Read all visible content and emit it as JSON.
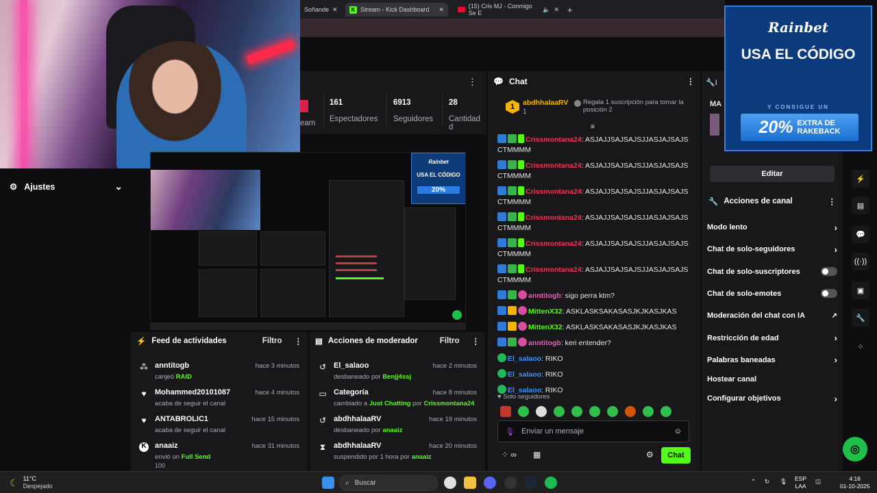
{
  "browser": {
    "tabs": [
      {
        "label": "Soñande"
      },
      {
        "label": "Stream - Kick Dashboard"
      },
      {
        "label": "(15) Cris MJ - Conmigo Se E"
      }
    ],
    "close_glyph": "✕",
    "new_tab_glyph": "+"
  },
  "left": {
    "settings_label": "Ajustes"
  },
  "stats": [
    {
      "value": "",
      "label": "eam"
    },
    {
      "value": "161",
      "label": "Espectadores"
    },
    {
      "value": "6913",
      "label": "Seguidores"
    },
    {
      "value": "28",
      "label": "Cantidad d"
    }
  ],
  "feed": {
    "title": "Feed de actividades",
    "filter": "Filtro",
    "items": [
      {
        "icon": "raid-icon",
        "name": "anntitogb",
        "time": "hace 3 minutos",
        "desc": "canjeó ",
        "highlight": "RAID"
      },
      {
        "icon": "heart-icon",
        "name": "Mohammed20101087",
        "time": "hace 4 minutos",
        "desc": "acaba de seguir el canal",
        "highlight": ""
      },
      {
        "icon": "heart-icon",
        "name": "ANTABROLIC1",
        "time": "hace 15 minutos",
        "desc": "acaba de seguir el canal",
        "highlight": ""
      },
      {
        "icon": "kick-icon",
        "name": "anaaiz",
        "time": "hace 31 minutos",
        "desc": "envió un ",
        "highlight": "Full Send",
        "extra": "100"
      }
    ]
  },
  "mod": {
    "title": "Acciones de moderador",
    "filter": "Filtro",
    "items": [
      {
        "icon": "undo-icon",
        "name": "El_salaoo",
        "time": "hace 2 minutos",
        "desc": "desbaneado por ",
        "by": "Benjj4ssj"
      },
      {
        "icon": "category-icon",
        "name": "Categoría",
        "time": "hace 8 minutos",
        "desc": "cambiado a ",
        "mid": "Just Chatting",
        "desc2": " por ",
        "by": "Crissmontana24"
      },
      {
        "icon": "undo-icon",
        "name": "abdhhalaaRV",
        "time": "hace 19 minutos",
        "desc": "desbaneado por ",
        "by": "anaaiz"
      },
      {
        "icon": "hourglass-icon",
        "name": "abdhhalaaRV",
        "time": "hace 20 minutos",
        "desc": "suspendido por 1 hora por ",
        "by": "anaaiz"
      }
    ]
  },
  "chat": {
    "title": "Chat",
    "pinned_user": "abdhhalaaRV",
    "pinned_rank": "1",
    "pinned_count": "1",
    "pinned_note": "Regala 1 suscripción para tomar la posición 2",
    "messages": [
      {
        "user": "Crissmontana24",
        "color": "red",
        "text": ": ASJAJJSAJSAJSJJASJAJSAJS CTMMMM"
      },
      {
        "user": "Crissmontana24",
        "color": "red",
        "text": ": ASJAJJSAJSAJSJJASJAJSAJS CTMMMM"
      },
      {
        "user": "Crissmontana24",
        "color": "red",
        "text": ": ASJAJJSAJSAJSJJASJAJSAJS CTMMMM"
      },
      {
        "user": "Crissmontana24",
        "color": "red",
        "text": ": ASJAJJSAJSAJSJJASJAJSAJS CTMMMM"
      },
      {
        "user": "Crissmontana24",
        "color": "red",
        "text": ": ASJAJJSAJSAJSJJASJAJSAJS CTMMMM"
      },
      {
        "user": "Crissmontana24",
        "color": "red",
        "text": ": ASJAJJSAJSAJSJJASJAJSAJS CTMMMM"
      },
      {
        "user": "anntitogb",
        "color": "pink",
        "text": ": sigo perra ktm?"
      },
      {
        "user": "MittenX32",
        "color": "green",
        "text": ": ASKLASKSAKASASJKJKASJKAS"
      },
      {
        "user": "MittenX32",
        "color": "green",
        "text": ": ASKLASKSAKASASJKJKASJKAS"
      },
      {
        "user": "anntitogb",
        "color": "pink",
        "text": ": keri entender?"
      },
      {
        "user": "El_salaoo",
        "color": "blue",
        "text": ": RIKO"
      },
      {
        "user": "El_salaoo",
        "color": "blue",
        "text": ": RIKO"
      },
      {
        "user": "El_salaoo",
        "color": "blue",
        "text": ": RIKO"
      }
    ],
    "followers_only": "Solo seguidores",
    "input_placeholder": "Enviar un mensaje",
    "send_label": "Chat"
  },
  "right": {
    "partial_title": "I",
    "partial_label": "MA",
    "edit_label": "Editar",
    "actions_title": "Acciones de canal",
    "options": [
      {
        "label": "Modo lento",
        "control": "chevron"
      },
      {
        "label": "Chat de solo-seguidores",
        "control": "chevron"
      },
      {
        "label": "Chat de solo-suscriptores",
        "control": "toggle"
      },
      {
        "label": "Chat de solo-emotes",
        "control": "toggle"
      },
      {
        "label": "Moderación del chat con IA",
        "control": "external"
      },
      {
        "label": "Restricción de edad",
        "control": "chevron"
      },
      {
        "label": "Palabras baneadas",
        "control": "chevron"
      },
      {
        "label": "Hostear canal",
        "control": "none"
      },
      {
        "label": "Configurar objetivos",
        "control": "chevron"
      }
    ]
  },
  "promo": {
    "brand": "Rainbet",
    "headline": "USA EL CÓDIGO",
    "sub": "Y CONSIGUE UN",
    "percent": "20%",
    "extra_line1": "EXTRA DE",
    "extra_line2": "RAKEBACK"
  },
  "preview": {
    "brand": "Rainbet",
    "headline": "USA EL CÓDIGO",
    "percent": "20%"
  },
  "taskbar": {
    "temp": "11°C",
    "weather": "Despejado",
    "search": "Buscar",
    "lang1": "ESP",
    "lang2": "LAA",
    "time": "4:16",
    "date": "01-10-2025"
  },
  "colors": {
    "kick_green": "#53fc18",
    "panel": "#18181b",
    "bg": "#0e0e10",
    "promo_blue": "#0b3a7d"
  }
}
